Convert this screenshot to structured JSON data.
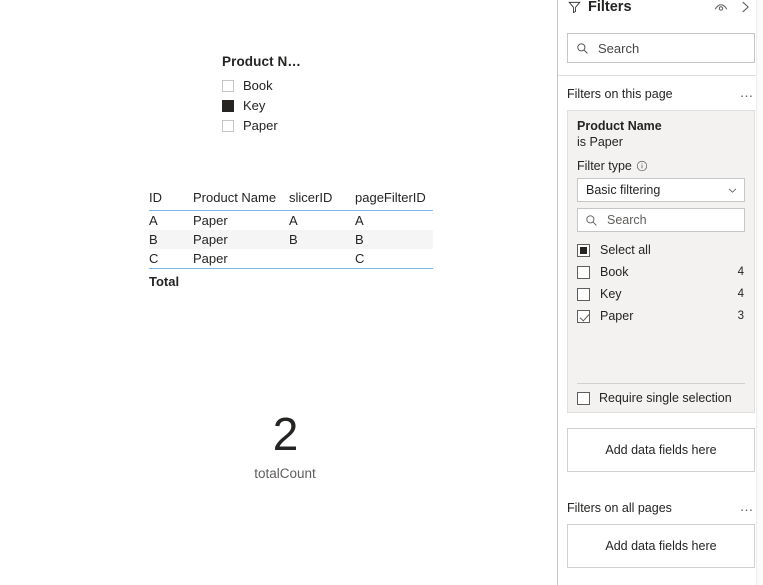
{
  "canvas": {
    "slicer": {
      "title": "Product N…",
      "items": [
        {
          "label": "Book",
          "selected": false
        },
        {
          "label": "Key",
          "selected": true
        },
        {
          "label": "Paper",
          "selected": false
        }
      ]
    },
    "table": {
      "columns": [
        "ID",
        "Product Name",
        "slicerID",
        "pageFilterID"
      ],
      "rows": [
        [
          "A",
          "Paper",
          "A",
          "A"
        ],
        [
          "B",
          "Paper",
          "B",
          "B"
        ],
        [
          "C",
          "Paper",
          "",
          "C"
        ]
      ],
      "total_label": "Total",
      "total_values": [
        "",
        "",
        ""
      ]
    },
    "card": {
      "value": "2",
      "label": "totalCount"
    }
  },
  "filters_pane": {
    "header": {
      "title": "Filters",
      "funnel_icon": "funnel-icon",
      "hide_icon": "eye-icon",
      "collapse_icon": "chevron-right-icon"
    },
    "search": {
      "placeholder": "Search",
      "icon": "search-icon"
    },
    "sections": {
      "this_page": {
        "title": "Filters on this page",
        "more_label": "…"
      },
      "all_pages": {
        "title": "Filters on all pages",
        "more_label": "…"
      }
    },
    "filter_card": {
      "field": "Product Name",
      "condition": "is Paper",
      "filter_type_label": "Filter type",
      "info_icon": "info-icon",
      "filter_type_value": "Basic filtering",
      "chevron_icon": "chevron-down-icon",
      "search_placeholder": "Search",
      "search_icon": "search-icon",
      "values": [
        {
          "label": "Select all",
          "count": "",
          "state": "indeterminate"
        },
        {
          "label": "Book",
          "count": "4",
          "state": "unchecked"
        },
        {
          "label": "Key",
          "count": "4",
          "state": "unchecked"
        },
        {
          "label": "Paper",
          "count": "3",
          "state": "checked"
        }
      ],
      "require_single_selection": {
        "label": "Require single selection",
        "checked": false
      }
    },
    "dropzones": {
      "page_level": "Add data fields here",
      "report_level": "Add data fields here"
    }
  },
  "colors": {
    "accent_line": "#7cb5e8",
    "text": "#252423",
    "muted_text": "#605e5c",
    "card_bg": "#f3f2f1",
    "alt_row": "#f5f5f5",
    "border": "#c8c6c4"
  }
}
